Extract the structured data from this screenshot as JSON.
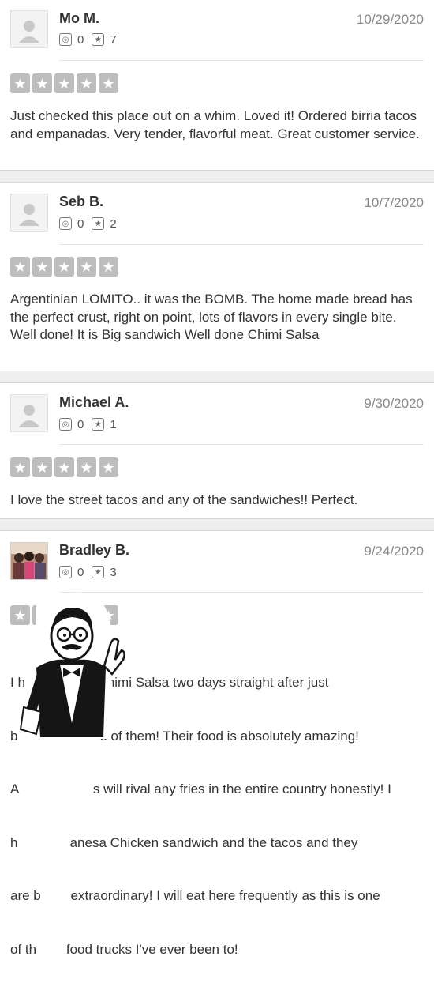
{
  "reviews": [
    {
      "name": "Mo M.",
      "date": "10/29/2020",
      "friends": "0",
      "reviews_count": "7",
      "rating": 5,
      "text": "Just checked this place out on a whim. Loved it! Ordered birria tacos and empanadas. Very tender, flavorful meat. Great customer service."
    },
    {
      "name": "Seb B.",
      "date": "10/7/2020",
      "friends": "0",
      "reviews_count": "2",
      "rating": 5,
      "text": "Argentinian LOMITO.. it was the BOMB. The home made bread has the perfect crust, right on point, lots of flavors in every single bite. Well done! It is Big sandwich Well done Chimi Salsa"
    },
    {
      "name": "Michael A.",
      "date": "9/30/2020",
      "friends": "0",
      "reviews_count": "1",
      "rating": 5,
      "text": "I love the street tacos and any of the sandwiches!! Perfect."
    },
    {
      "name": "Bradley B.",
      "date": "9/24/2020",
      "friends": "0",
      "reviews_count": "3",
      "rating": 5,
      "text_lines": [
        "I h                 a   himi Salsa two days straight after just",
        "b                      e of them! Their food is absolutely amazing!",
        "A                    s will rival any fries in the entire country honestly! I",
        "h              anesa Chicken sandwich and the tacos and they",
        "are b        extraordinary! I will eat here frequently as this is one",
        "of th        food trucks I've ever been to!"
      ]
    }
  ],
  "icons": {
    "friends": "friends-icon",
    "reviews": "reviews-count-icon",
    "star": "★",
    "stat_star": "★"
  },
  "colors": {
    "star_gray": "#bdbdbd",
    "separator": "#efefef"
  }
}
